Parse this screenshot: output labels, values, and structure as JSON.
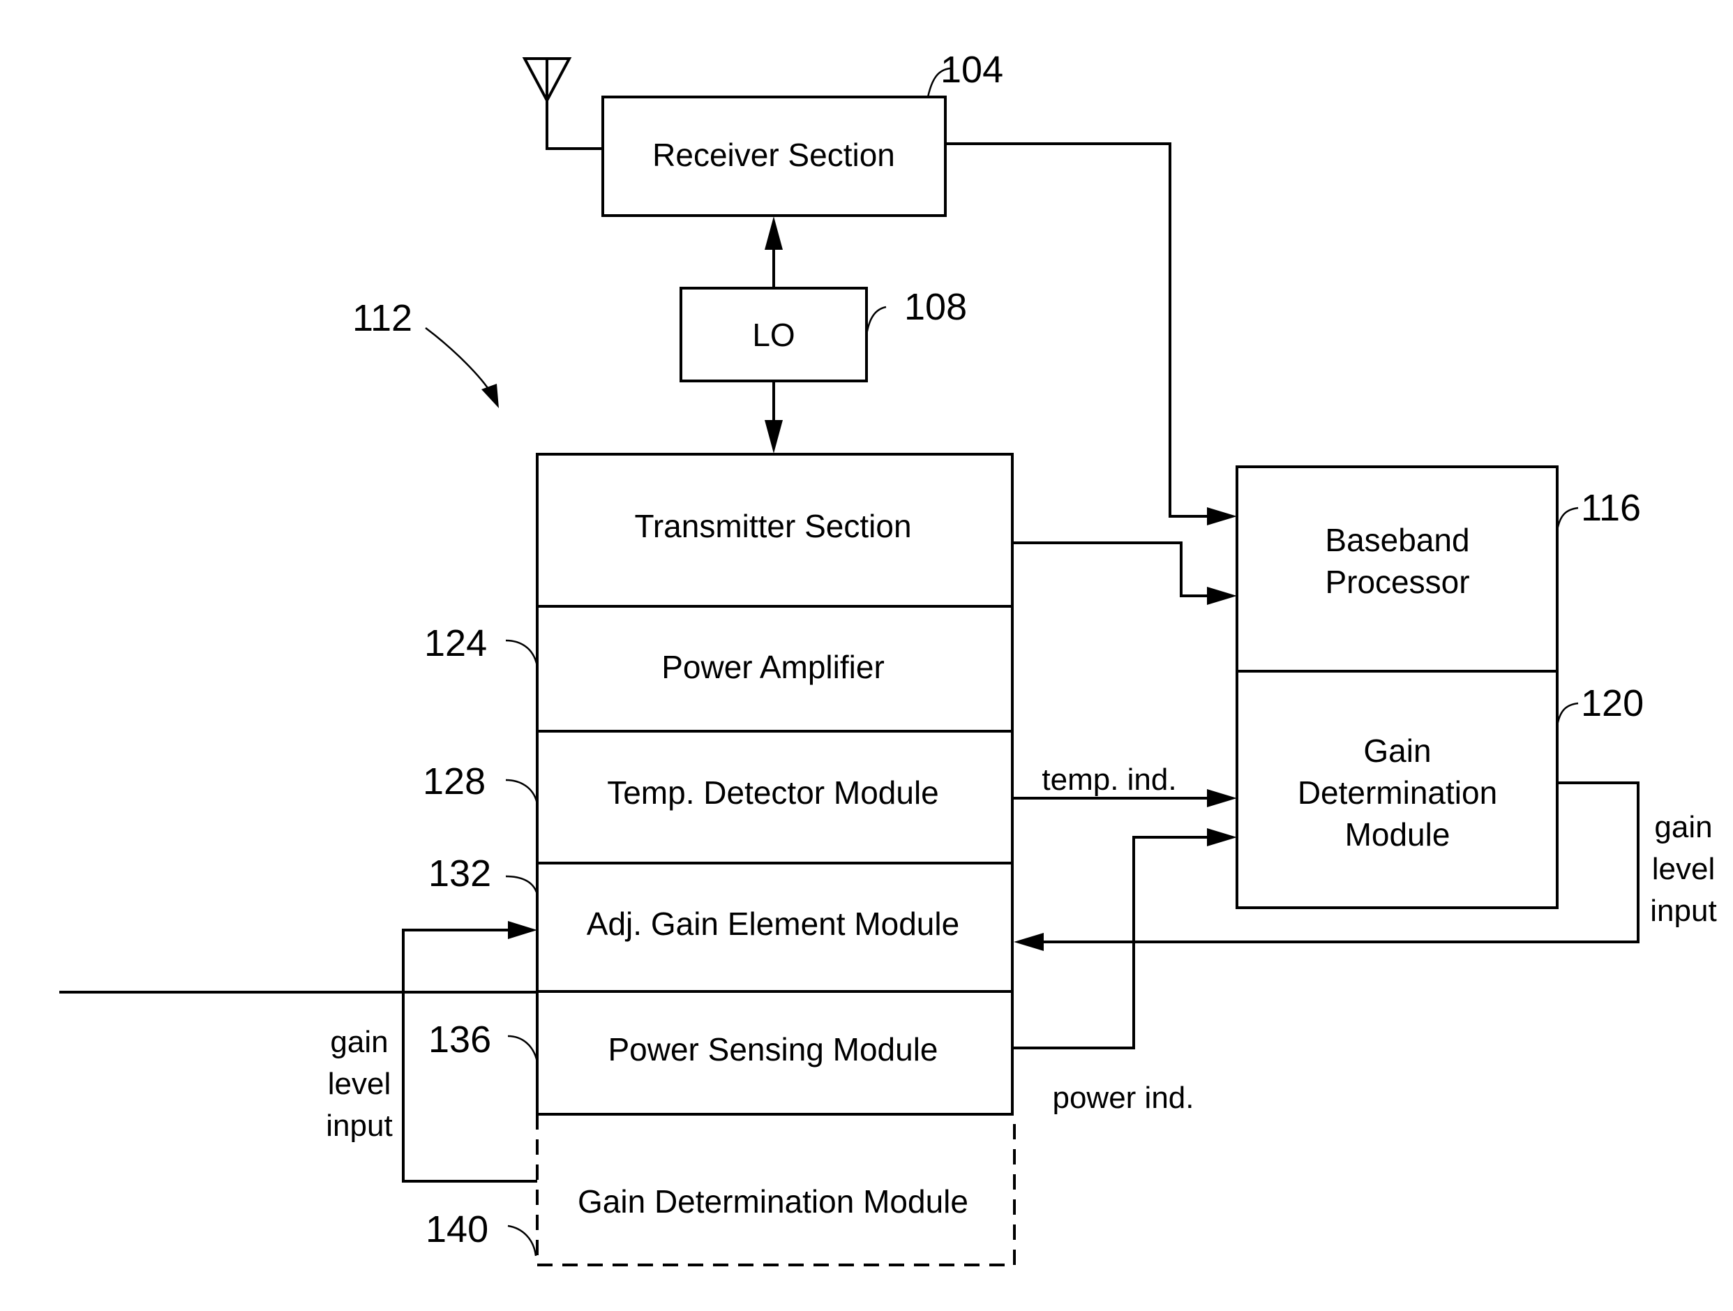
{
  "figure": {
    "overall_ref": "112",
    "blocks": {
      "receiver": {
        "label": "Receiver Section",
        "ref": "104"
      },
      "lo": {
        "label": "LO",
        "ref": "108"
      },
      "baseband": {
        "label_lines": [
          "Baseband",
          "Processor"
        ],
        "ref": "116"
      },
      "gain_right": {
        "label_lines": [
          "Gain",
          "Determination",
          "Module"
        ],
        "ref": "120"
      },
      "transmitter": {
        "label": "Transmitter Section"
      },
      "power_amplifier": {
        "label": "Power Amplifier",
        "ref": "124"
      },
      "temp_detector": {
        "label": "Temp. Detector Module",
        "ref": "128"
      },
      "adj_gain": {
        "label": "Adj. Gain Element Module",
        "ref": "132"
      },
      "power_sensing": {
        "label": "Power Sensing Module",
        "ref": "136"
      },
      "gain_bottom": {
        "label": "Gain Determination Module",
        "ref": "140",
        "style": "dashed"
      }
    },
    "signals": {
      "temp_ind": "temp. ind.",
      "power_ind": "power ind.",
      "gain_level_input_right": [
        "gain",
        "level",
        "input"
      ],
      "gain_level_input_left": [
        "gain",
        "level",
        "input"
      ]
    }
  }
}
